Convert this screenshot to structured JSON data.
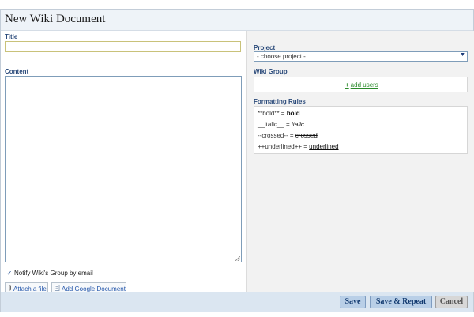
{
  "dialog": {
    "title": "New Wiki Document"
  },
  "left": {
    "title_label": "Title",
    "title_value": "",
    "content_label": "Content",
    "content_value": "",
    "notify": {
      "label": "Notify Wiki's Group by email",
      "checked_glyph": "✓"
    },
    "attach_file": {
      "label": "Attach a file",
      "icon": "paperclip-icon"
    },
    "add_google_doc": {
      "label": "Add Google Document",
      "icon": "document-icon"
    }
  },
  "right": {
    "project_label": "Project",
    "project_selected": "- choose project -",
    "wiki_group_label": "Wiki Group",
    "add_users": {
      "label": "add users",
      "plus": "+"
    },
    "formatting": {
      "label": "Formatting Rules",
      "rules": [
        {
          "syntax": "**bold** = ",
          "example": "bold",
          "style": "bold"
        },
        {
          "syntax": "__italic__ = ",
          "example": "italic",
          "style": "italic"
        },
        {
          "syntax": "--crossed-- = ",
          "example": "crossed",
          "style": "strike"
        },
        {
          "syntax": "++underlined++ = ",
          "example": "underlined",
          "style": "under"
        }
      ]
    }
  },
  "footer": {
    "save_label": "Save",
    "save_repeat_label": "Save & Repeat",
    "cancel_label": "Cancel"
  },
  "colors": {
    "accent_blue": "#2a4a7a",
    "link_green": "#2a8a2a",
    "footer_bg": "#dbe6f1"
  }
}
